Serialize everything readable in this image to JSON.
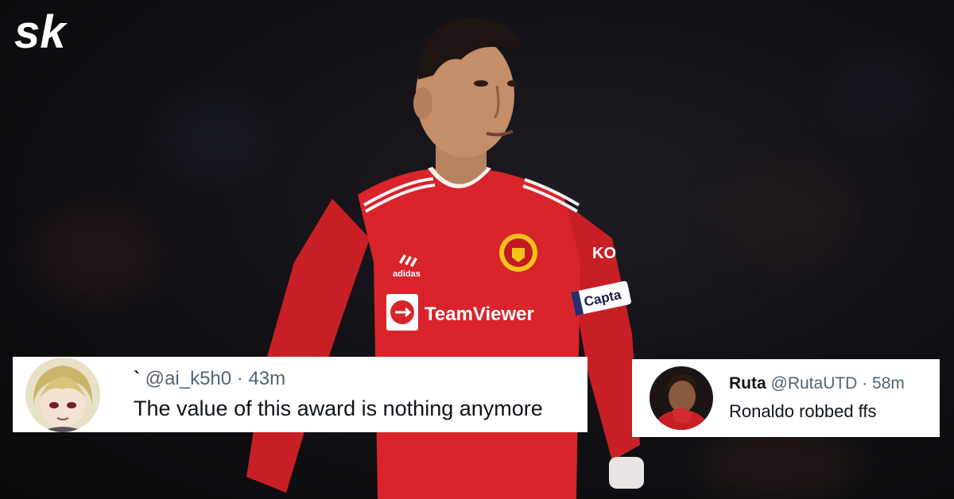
{
  "site": {
    "logo_text": "sk"
  },
  "photo": {
    "subject": "footballer in red home kit",
    "kit_sponsor": "TeamViewer",
    "kit_brand": "adidas",
    "armband": "Capta",
    "sleeve_sponsor": "KO",
    "kit_color": "#d8242a"
  },
  "tweets": [
    {
      "display_name": "`",
      "handle": "@ai_k5h0",
      "time": "43m",
      "text": "The value of this award is nothing anymore",
      "avatar_icon": "anime-avatar-icon"
    },
    {
      "display_name": "Ruta",
      "handle": "@RutaUTD",
      "time": "58m",
      "text": "Ronaldo robbed ffs",
      "avatar_icon": "player-avatar-icon"
    }
  ]
}
